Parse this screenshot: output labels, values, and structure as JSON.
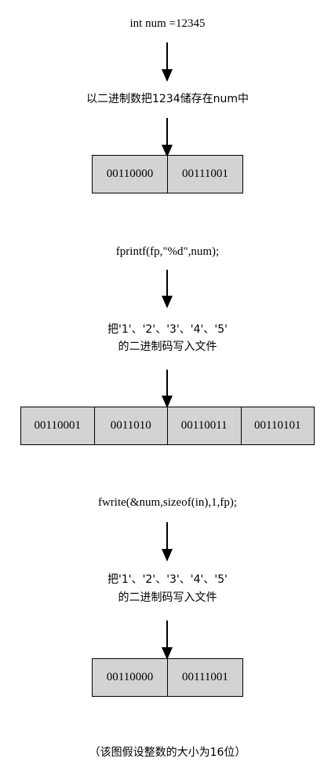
{
  "steps": {
    "declare": "int num =12345",
    "store": "以二进制数把1234储存在num中",
    "fprintf_call": "fprintf(fp,\"%d\",num);",
    "fprintf_desc_line1": "把'1'、'2'、'3'、'4'、'5'",
    "fprintf_desc_line2": "的二进制码写入文件",
    "fwrite_call": "fwrite(&num,sizeof(in),1,fp);",
    "fwrite_desc_line1": "把'1'、'2'、'3'、'4'、'5'",
    "fwrite_desc_line2": "的二进制码写入文件",
    "footnote": "（该图假设整数的大小为16位）"
  },
  "memory": {
    "stored": [
      "00110000",
      "00111001"
    ],
    "fprintf_file": [
      "00110001",
      "0011010",
      "00110011",
      "00110101"
    ],
    "fwrite_file": [
      "00110000",
      "00111001"
    ]
  },
  "colors": {
    "box_fill": "#d3d3d3",
    "stroke": "#000000"
  }
}
